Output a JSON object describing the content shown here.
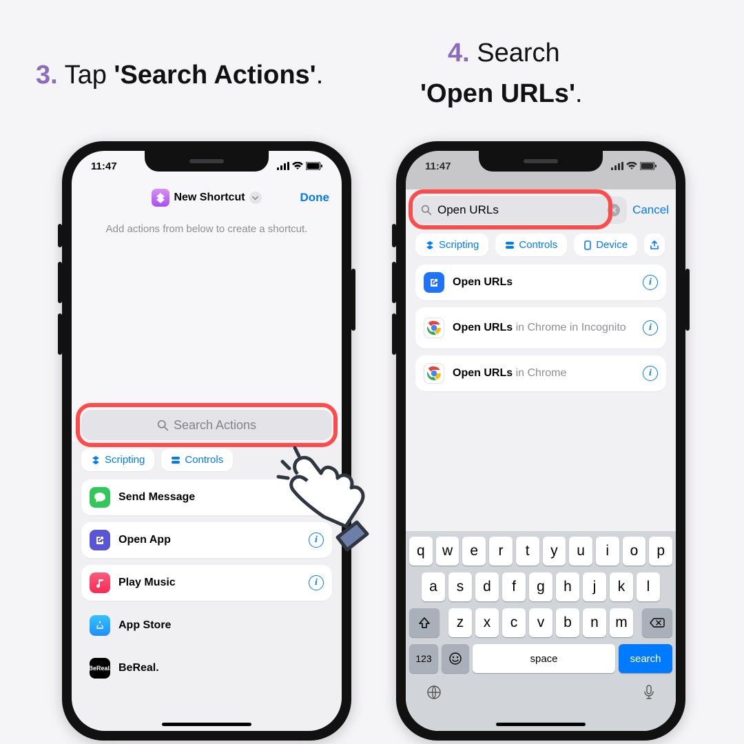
{
  "step3": {
    "num": "3.",
    "text_pre": " Tap ",
    "text_bold": "'Search Actions'",
    "text_post": "."
  },
  "step4": {
    "num": "4.",
    "text_pre": " Search",
    "text_bold": "'Open URLs'",
    "text_post": "."
  },
  "status_time": "11:47",
  "left": {
    "title": "New Shortcut",
    "done": "Done",
    "hint": "Add actions from below to create a shortcut.",
    "search_placeholder": "Search Actions",
    "chips": [
      "Scripting",
      "Controls"
    ],
    "actions": [
      {
        "icon": "message",
        "color": "#33c75a",
        "title": "Send Message",
        "info": false
      },
      {
        "icon": "open",
        "color": "#5856d6",
        "title": "Open App",
        "info": true
      },
      {
        "icon": "music",
        "color": "#fc3158",
        "title": "Play Music",
        "info": true
      },
      {
        "icon": "appstore",
        "color": "#1f8fff",
        "title": "App Store",
        "info": false
      },
      {
        "icon": "bereal",
        "color": "#000",
        "title": "BeReal.",
        "info": false
      }
    ]
  },
  "right": {
    "search_value": "Open URLs",
    "cancel": "Cancel",
    "chips": [
      "Scripting",
      "Controls",
      "Device"
    ],
    "results": [
      {
        "icon": "safari",
        "title_bold": "Open URLs",
        "title_plain": ""
      },
      {
        "icon": "chrome",
        "title_bold": "Open URLs",
        "title_plain": " in Chrome in Incognito"
      },
      {
        "icon": "chrome",
        "title_bold": "Open URLs",
        "title_plain": " in Chrome"
      }
    ],
    "keyboard": {
      "row1": [
        "q",
        "w",
        "e",
        "r",
        "t",
        "y",
        "u",
        "i",
        "o",
        "p"
      ],
      "row2": [
        "a",
        "s",
        "d",
        "f",
        "g",
        "h",
        "j",
        "k",
        "l"
      ],
      "row3": [
        "z",
        "x",
        "c",
        "v",
        "b",
        "n",
        "m"
      ],
      "key123": "123",
      "space": "space",
      "search": "search"
    }
  }
}
